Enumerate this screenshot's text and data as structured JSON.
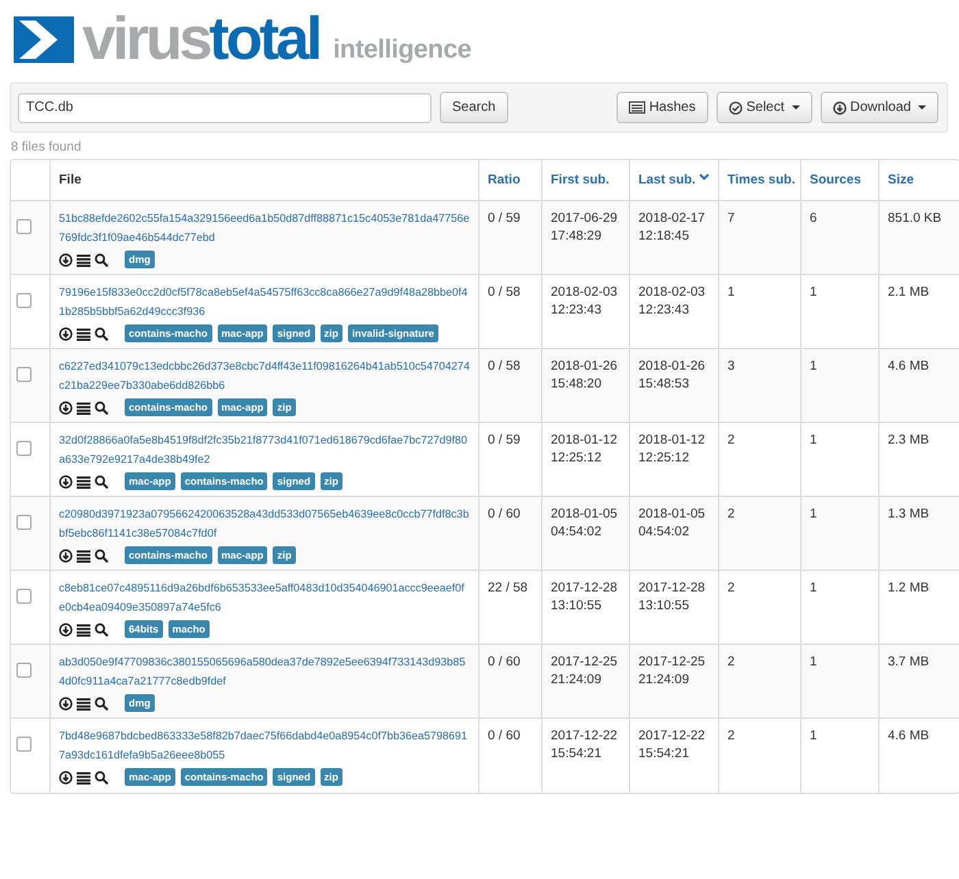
{
  "logo": {
    "brand_left": "virus",
    "brand_right": "total",
    "product": "intelligence"
  },
  "search": {
    "value": "TCC.db",
    "button": "Search"
  },
  "toolbar": {
    "buttons": [
      {
        "kind": "hashes",
        "label": "Hashes",
        "dropdown": false
      },
      {
        "kind": "select",
        "label": "Select",
        "dropdown": true
      },
      {
        "kind": "download",
        "label": "Download",
        "dropdown": true
      }
    ]
  },
  "result_count": "8 files found",
  "table": {
    "columns": [
      {
        "label": "File",
        "sortable": false,
        "sorted": false
      },
      {
        "label": "Ratio",
        "sortable": true,
        "sorted": false
      },
      {
        "label": "First sub.",
        "sortable": true,
        "sorted": false
      },
      {
        "label": "Last sub.",
        "sortable": true,
        "sorted": true
      },
      {
        "label": "Times sub.",
        "sortable": true,
        "sorted": false
      },
      {
        "label": "Sources",
        "sortable": true,
        "sorted": false
      },
      {
        "label": "Size",
        "sortable": true,
        "sorted": false
      }
    ],
    "rows": [
      {
        "checked": false,
        "hash": "51bc88efde2602c55fa154a329156eed6a1b50d87dff88871c15c4053e781da47756e769fdc3f1f09ae46b544dc77ebd",
        "tags": [
          "dmg"
        ],
        "ratio": "0 / 59",
        "first_sub": [
          "2017-06-29",
          "17:48:29"
        ],
        "last_sub": [
          "2018-02-17",
          "12:18:45"
        ],
        "times_sub": "7",
        "sources": "6",
        "size": "851.0 KB"
      },
      {
        "checked": false,
        "hash": "79196e15f833e0cc2d0cf5f78ca8eb5ef4a54575ff63cc8ca866e27a9d9f48a28bbe0f41b285b5bbf5a62d49ccc3f936",
        "tags": [
          "contains-macho",
          "mac-app",
          "signed",
          "zip",
          "invalid-signature"
        ],
        "ratio": "0 / 58",
        "first_sub": [
          "2018-02-03",
          "12:23:43"
        ],
        "last_sub": [
          "2018-02-03",
          "12:23:43"
        ],
        "times_sub": "1",
        "sources": "1",
        "size": "2.1 MB"
      },
      {
        "checked": false,
        "hash": "c6227ed341079c13edcbbc26d373e8cbc7d4ff43e11f09816264b41ab510c54704274c21ba229ee7b330abe6dd826bb6",
        "tags": [
          "contains-macho",
          "mac-app",
          "zip"
        ],
        "ratio": "0 / 58",
        "first_sub": [
          "2018-01-26",
          "15:48:20"
        ],
        "last_sub": [
          "2018-01-26",
          "15:48:53"
        ],
        "times_sub": "3",
        "sources": "1",
        "size": "4.6 MB"
      },
      {
        "checked": false,
        "hash": "32d0f28866a0fa5e8b4519f8df2fc35b21f8773d41f071ed618679cd6fae7bc727d9f80a633e792e9217a4de38b49fe2",
        "tags": [
          "mac-app",
          "contains-macho",
          "signed",
          "zip"
        ],
        "ratio": "0 / 59",
        "first_sub": [
          "2018-01-12",
          "12:25:12"
        ],
        "last_sub": [
          "2018-01-12",
          "12:25:12"
        ],
        "times_sub": "2",
        "sources": "1",
        "size": "2.3 MB"
      },
      {
        "checked": false,
        "hash": "c20980d3971923a0795662420063528a43dd533d07565eb4639ee8c0ccb77fdf8c3bbf5ebc86f1141c38e57084c7fd0f",
        "tags": [
          "contains-macho",
          "mac-app",
          "zip"
        ],
        "ratio": "0 / 60",
        "first_sub": [
          "2018-01-05",
          "04:54:02"
        ],
        "last_sub": [
          "2018-01-05",
          "04:54:02"
        ],
        "times_sub": "2",
        "sources": "1",
        "size": "1.3 MB"
      },
      {
        "checked": false,
        "hash": "c8eb81ce07c4895116d9a26bdf6b653533ee5aff0483d10d354046901accc9eeaef0fe0cb4ea09409e350897a74e5fc6",
        "tags": [
          "64bits",
          "macho"
        ],
        "ratio": "22 / 58",
        "first_sub": [
          "2017-12-28",
          "13:10:55"
        ],
        "last_sub": [
          "2017-12-28",
          "13:10:55"
        ],
        "times_sub": "2",
        "sources": "1",
        "size": "1.2 MB"
      },
      {
        "checked": false,
        "hash": "ab3d050e9f47709836c380155065696a580dea37de7892e5ee6394f733143d93b854d0fc911a4ca7a21777c8edb9fdef",
        "tags": [
          "dmg"
        ],
        "ratio": "0 / 60",
        "first_sub": [
          "2017-12-25",
          "21:24:09"
        ],
        "last_sub": [
          "2017-12-25",
          "21:24:09"
        ],
        "times_sub": "2",
        "sources": "1",
        "size": "3.7 MB"
      },
      {
        "checked": false,
        "hash": "7bd48e9687bdcbed863333e58f82b7daec75f66dabd4e0a8954c0f7bb36ea57986917a93dc161dfefa9b5a26eee8b055",
        "tags": [
          "mac-app",
          "contains-macho",
          "signed",
          "zip"
        ],
        "ratio": "0 / 60",
        "first_sub": [
          "2017-12-22",
          "15:54:21"
        ],
        "last_sub": [
          "2017-12-22",
          "15:54:21"
        ],
        "times_sub": "2",
        "sources": "1",
        "size": "4.6 MB"
      }
    ]
  }
}
